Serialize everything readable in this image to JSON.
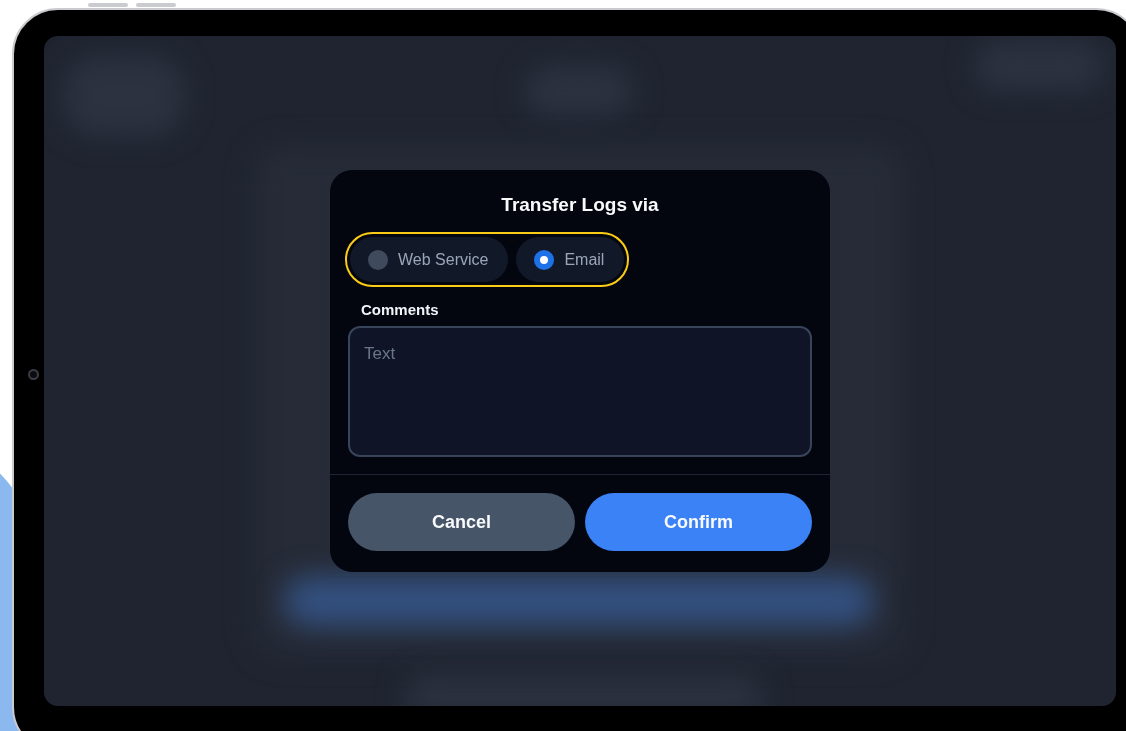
{
  "dialog": {
    "title": "Transfer Logs via",
    "transfer_options": {
      "focused": true,
      "options": [
        {
          "label": "Web Service",
          "selected": false
        },
        {
          "label": "Email",
          "selected": true
        }
      ]
    },
    "comments": {
      "label": "Comments",
      "placeholder": "Text"
    },
    "buttons": [
      {
        "label": "Cancel",
        "kind": "secondary"
      },
      {
        "label": "Confirm",
        "kind": "primary"
      }
    ]
  }
}
